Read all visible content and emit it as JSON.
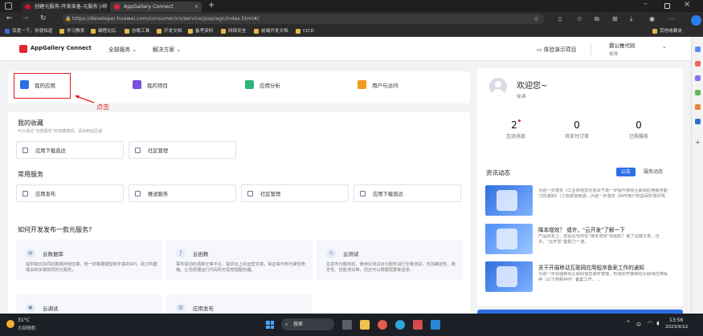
{
  "browser": {
    "tabs": [
      {
        "title": "创建元服务-开发准备-元服务 | 华",
        "active": false
      },
      {
        "title": "AppGallery Connect",
        "active": true
      }
    ],
    "url": "https://developer.huawei.com/consumer/cn/service/josp/agc/index.html#/",
    "bookmarks": [
      "百度一下，你就知道",
      "学习教育",
      "编程论坛",
      "谷歌工具",
      "开发文档",
      "备考资料",
      "网络安全",
      "前端开发文档",
      "CICD"
    ],
    "other_bookmarks": "其他收藏夹"
  },
  "header": {
    "logo": "AppGallery Connect",
    "nav": [
      "全部服务",
      "解决方案"
    ],
    "demo": "体验演示项目",
    "account_line1": "鼎公推代码",
    "account_line2": "徐涛"
  },
  "quick": [
    {
      "label": "我的应用",
      "icon": "apps-icon",
      "color": "#2e6fe6"
    },
    {
      "label": "我的项目",
      "icon": "project-icon",
      "color": "#7b4fe0"
    },
    {
      "label": "应用分析",
      "icon": "analysis-icon",
      "color": "#2fb37a"
    },
    {
      "label": "用户与访问",
      "icon": "user-access-icon",
      "color": "#f19c1f"
    }
  ],
  "annotation": "点击",
  "favorites": {
    "title": "我的收藏",
    "hint": "可以通过“全部服务”的收藏按钮，添加到此区域",
    "items": [
      "应用下载直达",
      "社区管理"
    ]
  },
  "common": {
    "title": "常用服务",
    "items": [
      "应用发布",
      "推送服务",
      "社区管理",
      "应用下载直达"
    ]
  },
  "howto": {
    "title": "如何开发发布一款元服务?",
    "cards": [
      {
        "title": "云数据库",
        "desc": "提供端云协同的数据存储支撑，统一的数据模型和丰富的API，助力构建端云和多端协同的元服务。"
      },
      {
        "title": "云函数",
        "desc": "事件驱动的函数计算平台，提供云上的运营支撑，保证高可用与弹性伸缩，让您便捷运行代码而无需管理服务器。"
      },
      {
        "title": "云测试",
        "desc": "在发布元服务前，使用云测试对元服务进行全量测试，包括兼容性、稳定性、性能测试等，您还可以根据需要筹选测…"
      },
      {
        "title": "云调试",
        "desc": ""
      },
      {
        "title": "应用发布",
        "desc": ""
      }
    ]
  },
  "welcome": {
    "greeting": "欢迎您~",
    "name": "徐涛",
    "stats": [
      {
        "value": "2",
        "label": "互动消息",
        "dot": true
      },
      {
        "value": "0",
        "label": "待支付订单",
        "dot": false
      },
      {
        "value": "0",
        "label": "已购服务",
        "dot": false
      }
    ]
  },
  "news": {
    "title": "资讯动态",
    "tabs": [
      "公告",
      "服务动态"
    ],
    "items": [
      {
        "title": "",
        "desc": "为进一步落实《工业和信息化部关于进一步提升移动互联网应用服务能力的通知》（工信部信管函…为进一步落实《APP用户权益保护测评规…"
      },
      {
        "title": "降本增效？ 或许，“云开发”了解一下",
        "desc": "产品研发上，您是否也存在“降本增效”的困扰？看了这篇文章，也许，“云开发”能助力一波。"
      },
      {
        "title": "关于开展移动互联网应用程序备案工作的通知",
        "desc": "为进一步加强移动互联网信息服务管理，现组织开展移动互联网应用程序（以下简称APP）备案工作。…"
      }
    ]
  },
  "taskbar": {
    "weather_temp": "31°C",
    "weather_desc": "大部晴朗",
    "search": "搜索",
    "time": "13:56",
    "date": "2023/9/22"
  }
}
